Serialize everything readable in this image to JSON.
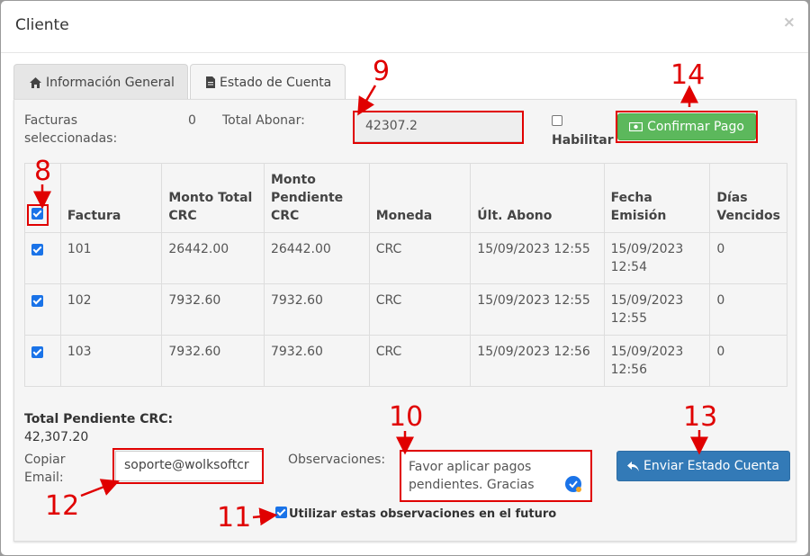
{
  "modal": {
    "title": "Cliente",
    "close": "×"
  },
  "tabs": [
    {
      "label": "Información General"
    },
    {
      "label": "Estado de Cuenta"
    }
  ],
  "summary": {
    "facturas_label_1": "Facturas",
    "facturas_label_2": "seleccionadas:",
    "facturas_count": "0",
    "total_abonar_label": "Total Abonar:",
    "total_abonar_value": "42307.2",
    "habilitar_label": "Habilitar",
    "confirmar_label": "Confirmar Pago"
  },
  "table": {
    "headers": [
      "Factura",
      "Monto Total CRC",
      "Monto Pendiente CRC",
      "Moneda",
      "Últ. Abono",
      "Fecha Emisión",
      "Días Vencidos"
    ],
    "header_lines": {
      "monto_total": [
        "Monto Total",
        "CRC"
      ],
      "monto_pendiente": [
        "Monto",
        "Pendiente",
        "CRC"
      ],
      "fecha": [
        "Fecha",
        "Emisión"
      ],
      "dias": [
        "Días",
        "Vencidos"
      ]
    },
    "rows": [
      {
        "factura": "101",
        "total": "26442.00",
        "pendiente": "26442.00",
        "moneda": "CRC",
        "ultimo": "15/09/2023 12:55",
        "fecha_1": "15/09/2023",
        "fecha_2": "12:54",
        "dias": "0"
      },
      {
        "factura": "102",
        "total": "7932.60",
        "pendiente": "7932.60",
        "moneda": "CRC",
        "ultimo": "15/09/2023 12:55",
        "fecha_1": "15/09/2023",
        "fecha_2": "12:55",
        "dias": "0"
      },
      {
        "factura": "103",
        "total": "7932.60",
        "pendiente": "7932.60",
        "moneda": "CRC",
        "ultimo": "15/09/2023 12:56",
        "fecha_1": "15/09/2023",
        "fecha_2": "12:56",
        "dias": "0"
      }
    ]
  },
  "footer": {
    "total_label": "Total Pendiente CRC:",
    "total_value": "42,307.20",
    "copiar_1": "Copiar",
    "copiar_2": "Email:",
    "email_value": "soporte@wolksoftcr",
    "obs_label": "Observaciones:",
    "obs_value_1": "Favor aplicar pagos",
    "obs_value_2": "pendientes. Gracias",
    "enviar_label": "Enviar Estado Cuenta",
    "utilizar_label": "Utilizar estas observaciones en el futuro"
  },
  "annotations": [
    "8",
    "9",
    "10",
    "11",
    "12",
    "13",
    "14"
  ],
  "colors": {
    "annotation": "#e00000",
    "green": "#5cb85c",
    "blue": "#337ab7",
    "checkbox": "#1a73e8"
  }
}
